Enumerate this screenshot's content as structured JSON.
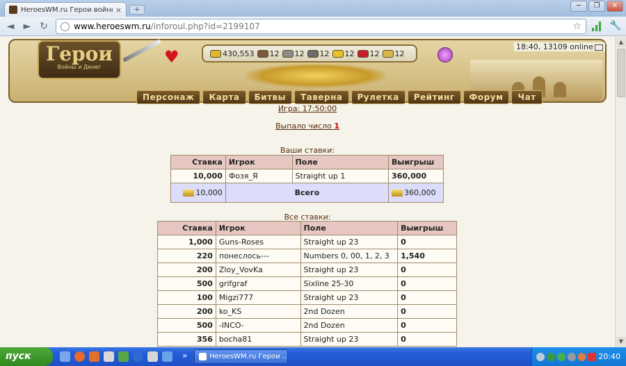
{
  "browser": {
    "tab_title": "HeroesWM.ru Герои войны и",
    "tab_close": "×",
    "new_tab": "+",
    "url_host": "www.heroeswm.ru",
    "url_path": "/inforoul.php?id=2199107",
    "back_icon": "◄",
    "forward_icon": "►",
    "reload_icon": "↻",
    "star_icon": "☆",
    "wrench_icon": "🔧",
    "win_min": "─",
    "win_max": "❐",
    "win_close": "✕"
  },
  "header": {
    "logo_title": "Герои",
    "logo_sub": "Войны и Денег",
    "time_online": "18:40, 13109 online",
    "resources": [
      {
        "value": "430,553",
        "color": "#e0b72e"
      },
      {
        "value": "12",
        "color": "#7a5a3a"
      },
      {
        "value": "12",
        "color": "#8c8c8c"
      },
      {
        "value": "12",
        "color": "#6b6b6b"
      },
      {
        "value": "12",
        "color": "#e8c228"
      },
      {
        "value": "12",
        "color": "#c91f2c"
      },
      {
        "value": "12",
        "color": "#d9b84a"
      }
    ],
    "nav": [
      "Персонаж",
      "Карта",
      "Битвы",
      "Таверна",
      "Рулетка",
      "Рейтинг",
      "Форум",
      "Чат"
    ]
  },
  "game": {
    "game_time": "Игра: 17:50:00",
    "result_label": "Выпало число",
    "result_number": "1"
  },
  "your_bets": {
    "caption": "Ваши ставки:",
    "headers": [
      "Ставка",
      "Игрок",
      "Поле",
      "Выигрыш"
    ],
    "rows": [
      {
        "bet": "10,000",
        "player": "Фозя_Я",
        "field": "Straight up 1",
        "win": "360,000"
      }
    ],
    "total_bet": "10,000",
    "total_label": "Всего",
    "total_win": "360,000"
  },
  "all_bets": {
    "caption": "Все ставки:",
    "headers": [
      "Ставка",
      "Игрок",
      "Поле",
      "Выигрыш"
    ],
    "rows": [
      {
        "bet": "1,000",
        "player": "Guns-Roses",
        "field": "Straight up 23",
        "win": "0"
      },
      {
        "bet": "220",
        "player": "понеслось---",
        "field": "Numbers 0, 00, 1, 2, 3",
        "win": "1,540"
      },
      {
        "bet": "200",
        "player": "Zloy_VovKa",
        "field": "Straight up 23",
        "win": "0"
      },
      {
        "bet": "500",
        "player": "grifgraf",
        "field": "Sixline 25-30",
        "win": "0"
      },
      {
        "bet": "100",
        "player": "Migzi777",
        "field": "Straight up 23",
        "win": "0"
      },
      {
        "bet": "200",
        "player": "ko_KS",
        "field": "2nd Dozen",
        "win": "0"
      },
      {
        "bet": "500",
        "player": "-INCO-",
        "field": "2nd Dozen",
        "win": "0"
      },
      {
        "bet": "356",
        "player": "bocha81",
        "field": "Straight up 23",
        "win": "0"
      }
    ]
  },
  "taskbar": {
    "start_label": "пуск",
    "task_label": "HeroesWM.ru Герои ...",
    "task_arrow": "»",
    "clock": "20:40"
  }
}
